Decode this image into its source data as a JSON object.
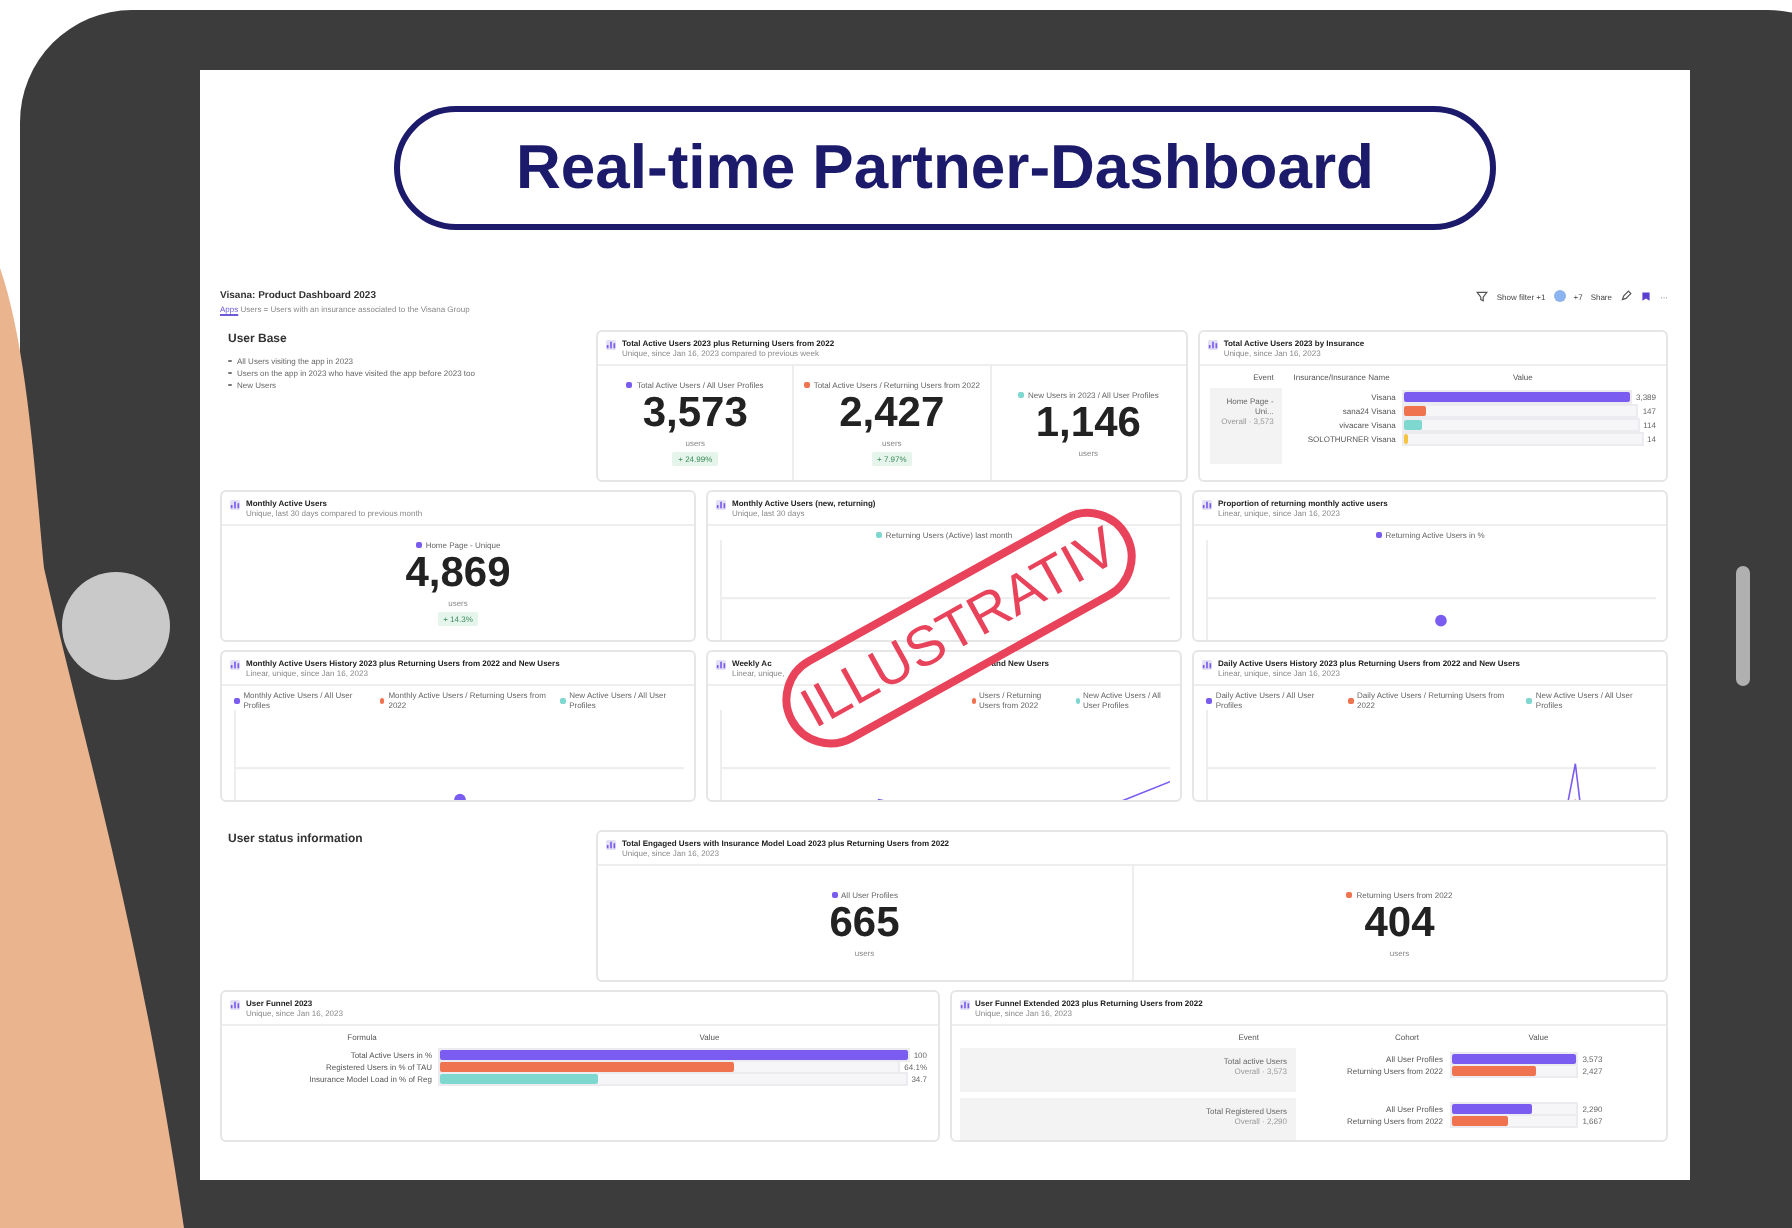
{
  "banner": {
    "title": "Real-time Partner-Dashboard"
  },
  "stamp": {
    "text": "ILLUSTRATIV"
  },
  "dashboard": {
    "title": "Visana: Product Dashboard 2023",
    "link": "Apps",
    "description": "Users = Users with an insurance associated to the Visana Group",
    "filter": "Show filter +1",
    "avatars": "+7",
    "share": "Share",
    "more": "···"
  },
  "rows": [
    {
      "items": [
        {
          "kind": "intro",
          "heading": "User Base",
          "bullets": [
            "All Users visiting the app in 2023",
            "Users on the app in 2023 who have visited the app before 2023 too",
            "New Users"
          ]
        },
        {
          "kind": "metrics",
          "title": "Total Active Users 2023 plus Returning Users from 2022",
          "subtitle": "Unique, since Jan 16, 2023 compared to previous week",
          "metrics": [
            {
              "legend": "Total Active Users / All User Profiles",
              "color": "#7b5cf0",
              "value": "3,573",
              "unit": "users",
              "change": "+ 24.99%"
            },
            {
              "legend": "Total Active Users / Returning Users from 2022",
              "color": "#f0734f",
              "value": "2,427",
              "unit": "users",
              "change": "+ 7.97%"
            },
            {
              "legend": "New Users in 2023 / All User Profiles",
              "color": "#7fd8d0",
              "value": "1,146",
              "unit": "users"
            }
          ]
        },
        {
          "kind": "bars",
          "title": "Total Active Users 2023 by Insurance",
          "subtitle": "Unique, since Jan 16, 2023",
          "columns": [
            "Event",
            "Insurance/Insurance Name",
            "Value"
          ],
          "event": "Home Page - Uni...",
          "event_sub": "Overall · 3,573",
          "rows": [
            {
              "label": "Visana",
              "level": 1,
              "color": "#7b5cf0",
              "value": "3,389"
            },
            {
              "label": "sana24 Visana",
              "level": 0.1,
              "color": "#f0734f",
              "value": "147"
            },
            {
              "label": "vivacare Visana",
              "level": 0.08,
              "color": "#7fd8d0",
              "value": "114"
            },
            {
              "label": "SOLOTHURNER Visana",
              "level": 0.02,
              "color": "#f5c542",
              "value": "14"
            }
          ]
        }
      ]
    },
    {
      "items": [
        {
          "kind": "single",
          "title": "Monthly Active Users",
          "subtitle": "Unique, last 30 days compared to previous month",
          "legend": "Home Page - Unique",
          "color": "#7b5cf0",
          "value": "4,869",
          "unit": "users",
          "change": "+ 14.3%"
        },
        {
          "kind": "donut",
          "title": "Monthly Active Users (new, returning)",
          "subtitle": "Unique, last 30 days",
          "legend": [
            {
              "label": "Returning Users (Active) last month",
              "color": "#7fd8d0"
            }
          ]
        },
        {
          "kind": "proportion",
          "title": "Proportion of returning monthly active users",
          "subtitle": "Linear, unique, since Jan 16, 2023",
          "legend": [
            {
              "label": "Returning Active Users in %",
              "color": "#7b5cf0"
            }
          ]
        }
      ]
    },
    {
      "items": [
        {
          "kind": "dots",
          "title": "Monthly Active Users History 2023 plus Returning Users from 2022 and New Users",
          "subtitle": "Linear, unique, since Jan 16, 2023",
          "legend": [
            {
              "label": "Monthly Active Users / All User Profiles",
              "color": "#7b5cf0"
            },
            {
              "label": "Monthly Active Users / Returning Users from 2022",
              "color": "#f0734f"
            },
            {
              "label": "New Active Users / All User Profiles",
              "color": "#7fd8d0"
            }
          ]
        },
        {
          "kind": "weekly",
          "title": "Weekly Ac",
          "title_end": "and New Users",
          "subtitle": "Linear, unique,",
          "legend": [
            {
              "color": "#7b5cf0"
            },
            {
              "label": "Users / Returning Users from 2022",
              "color": "#f0734f"
            },
            {
              "label": "New Active Users / All User Profiles",
              "color": "#7fd8d0"
            }
          ]
        },
        {
          "kind": "daily",
          "title": "Daily Active Users History 2023 plus Returning Users from 2022 and New Users",
          "subtitle": "Linear, unique, since Jan 16, 2023",
          "legend": [
            {
              "label": "Daily Active Users / All User Profiles",
              "color": "#7b5cf0"
            },
            {
              "label": "Daily Active Users / Returning Users from 2022",
              "color": "#f0734f"
            },
            {
              "label": "New Active Users / All User Profiles",
              "color": "#7fd8d0"
            }
          ]
        }
      ]
    },
    {
      "items": [
        {
          "kind": "intro",
          "heading": "User status information"
        },
        {
          "kind": "metrics",
          "title": "Total Engaged Users with Insurance Model Load 2023 plus Returning Users from 2022",
          "subtitle": "Unique, since Jan 16, 2023",
          "metrics": [
            {
              "legend": "All User Profiles",
              "color": "#7b5cf0",
              "value": "665",
              "unit": "users"
            },
            {
              "legend": "Returning Users from 2022",
              "color": "#f0734f",
              "value": "404",
              "unit": "users"
            }
          ]
        }
      ]
    },
    {
      "items": [
        {
          "kind": "funnel",
          "title": "User Funnel 2023",
          "subtitle": "Unique, since Jan 16, 2023",
          "columns": [
            "Formula",
            "Value"
          ],
          "rows": [
            {
              "label": "Total Active Users in %",
              "level": 1,
              "color": "#7b5cf0",
              "value": "100"
            },
            {
              "label": "Registered Users in % of TAU",
              "level": 0.64,
              "color": "#f0734f",
              "value": "64.1%"
            },
            {
              "label": "Insurance Model Load in % of Reg",
              "level": 0.34,
              "color": "#7fd8d0",
              "value": "34.7"
            }
          ]
        },
        {
          "kind": "funnel_ext",
          "title": "User Funnel Extended 2023 plus Returning Users from 2022",
          "subtitle": "Unique, since Jan 16, 2023",
          "columns": [
            "Event",
            "Cohort",
            "Value"
          ],
          "groups": [
            {
              "event": "Total active Users",
              "event_sub": "Overall · 3,573",
              "rows": [
                {
                  "label": "All User Profiles",
                  "level": 1,
                  "color": "#7b5cf0",
                  "value": "3,573"
                },
                {
                  "label": "Returning Users from 2022",
                  "level": 0.68,
                  "color": "#f0734f",
                  "value": "2,427"
                }
              ]
            },
            {
              "event": "Total Registered Users",
              "event_sub": "Overall · 2,290",
              "rows": [
                {
                  "label": "All User Profiles",
                  "level": 0.64,
                  "color": "#7b5cf0",
                  "value": "2,290"
                },
                {
                  "label": "Returning Users from 2022",
                  "level": 0.45,
                  "color": "#f0734f",
                  "value": "1,667"
                }
              ]
            }
          ]
        }
      ]
    }
  ]
}
